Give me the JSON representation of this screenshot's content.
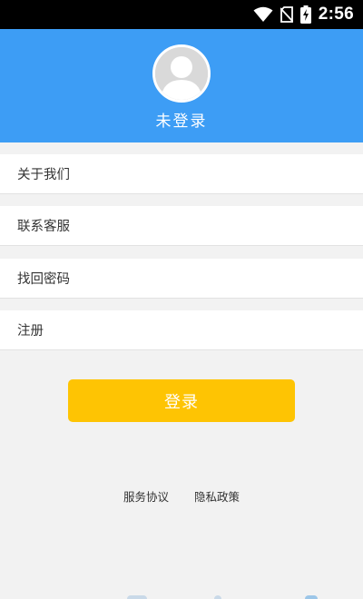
{
  "status_bar": {
    "time": "2:56",
    "icons": [
      "wifi-icon",
      "no-sim-icon",
      "battery-charging-icon"
    ]
  },
  "header": {
    "avatar_icon": "default-avatar-icon",
    "username": "未登录",
    "background_color": "#3d9df5"
  },
  "menu": {
    "items": [
      {
        "label": "关于我们"
      },
      {
        "label": "联系客服"
      },
      {
        "label": "找回密码"
      },
      {
        "label": "注册"
      }
    ]
  },
  "login_button": {
    "label": "登录",
    "color": "#fec403"
  },
  "footer": {
    "service_agreement": "服务协议",
    "privacy_policy": "隐私政策"
  }
}
